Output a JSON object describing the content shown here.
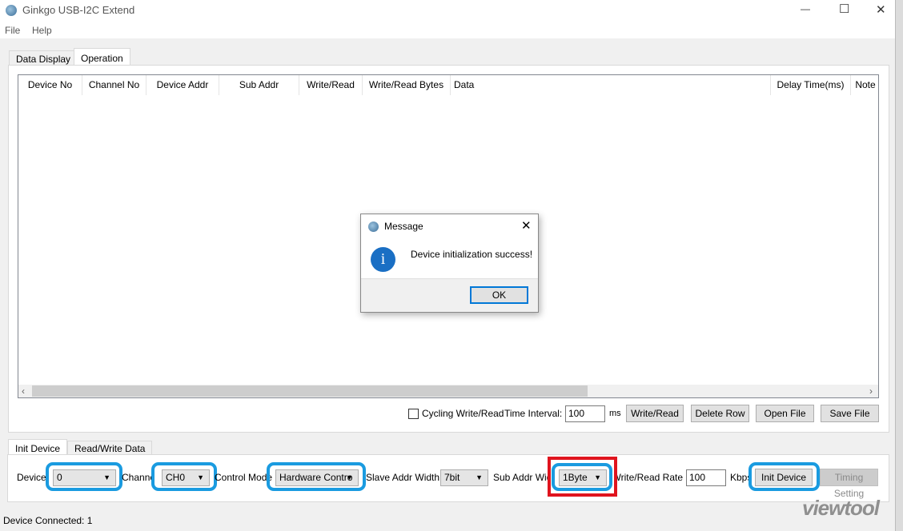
{
  "window": {
    "title": "Ginkgo USB-I2C Extend",
    "minimize": "—",
    "maximize": "☐",
    "close": "✕"
  },
  "menu": [
    "File",
    "Help"
  ],
  "top_tabs": [
    {
      "label": "Data Display",
      "active": false
    },
    {
      "label": "Operation",
      "active": true
    }
  ],
  "table": {
    "columns": [
      "Device No",
      "Channel No",
      "Device Addr",
      "Sub Addr",
      "Write/Read",
      "Write/Read Bytes",
      "Data",
      "Delay Time(ms)",
      "Note"
    ],
    "rows": []
  },
  "operation_bar": {
    "cycling_label": "Cycling Write/Read",
    "cycling_checked": false,
    "interval_label": "Time Interval:",
    "interval_value": "100",
    "interval_unit": "ms",
    "buttons": [
      "Write/Read",
      "Delete Row",
      "Open File",
      "Save File"
    ]
  },
  "bottom_tabs": [
    {
      "label": "Init Device",
      "active": true
    },
    {
      "label": "Read/Write Data",
      "active": false
    }
  ],
  "init": {
    "device_label": "Device:",
    "device_value": "0",
    "channel_label": "Channel:",
    "channel_value": "CH0",
    "mode_label": "Control Mode",
    "mode_value": "Hardware Contro",
    "slave_label": "Slave Addr Width:",
    "slave_value": "7bit",
    "sub_label": "Sub Addr Width",
    "sub_value": "1Byte",
    "rate_label": "Write/Read Rate:",
    "rate_value": "100",
    "rate_unit": "Kbps",
    "init_button": "Init Device",
    "timing_button": "Timing Setting"
  },
  "status": "Device Connected: 1",
  "dialog": {
    "title": "Message",
    "message": "Device initialization success!",
    "ok": "OK",
    "icon": "info-icon"
  },
  "watermark": "viewtool",
  "colors": {
    "highlight_blue": "#1a9be0",
    "highlight_red": "#e0141e",
    "info_blue": "#1a6fc4"
  }
}
